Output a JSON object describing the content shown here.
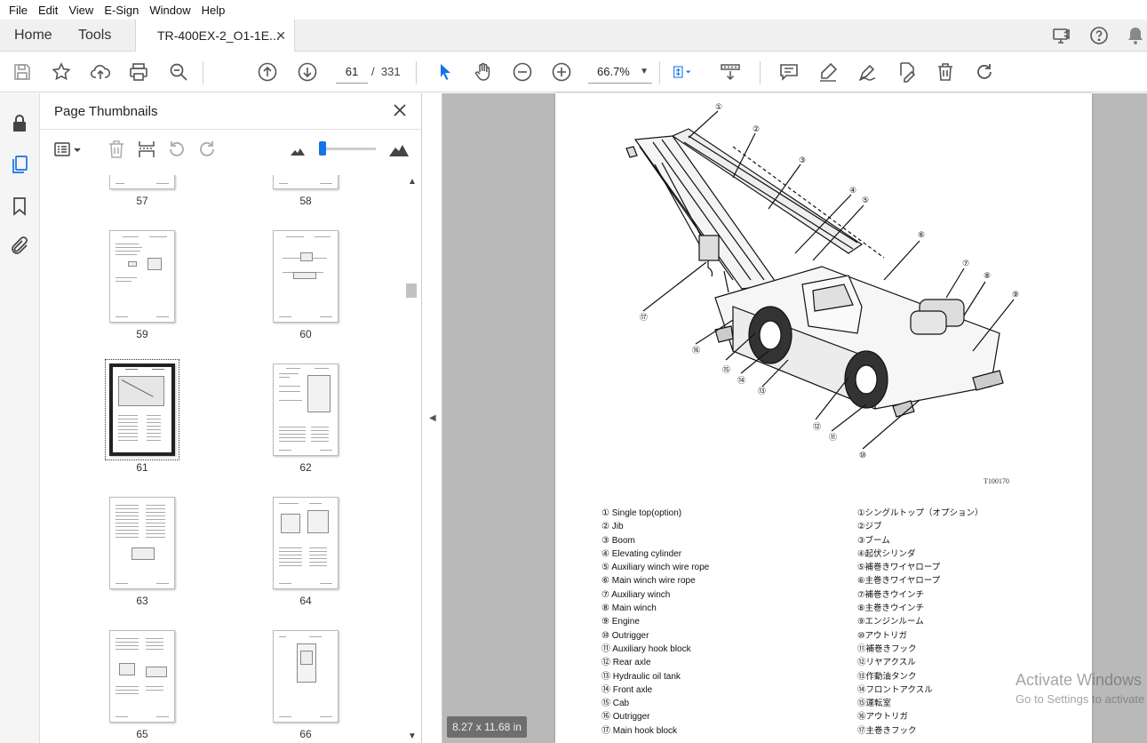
{
  "menu": [
    "File",
    "Edit",
    "View",
    "E-Sign",
    "Window",
    "Help"
  ],
  "tabs": {
    "home": "Home",
    "tools": "Tools",
    "document_title": "TR-400EX-2_O1-1E...",
    "close_glyph": "✕"
  },
  "toolbar": {
    "current_page": "61",
    "page_separator": "/",
    "total_pages": "331",
    "zoom": "66.7%"
  },
  "panel": {
    "title": "Page Thumbnails",
    "close_glyph": "✕",
    "thumbnails": [
      {
        "label": "57"
      },
      {
        "label": "58"
      },
      {
        "label": "59"
      },
      {
        "label": "60"
      },
      {
        "label": "61",
        "selected": true
      },
      {
        "label": "62"
      },
      {
        "label": "63"
      },
      {
        "label": "64"
      },
      {
        "label": "65"
      },
      {
        "label": "66"
      }
    ]
  },
  "document": {
    "figure_code": "T100170",
    "callouts": [
      "①",
      "②",
      "③",
      "④",
      "⑤",
      "⑥",
      "⑦",
      "⑧",
      "⑨",
      "⑩",
      "⑪",
      "⑫",
      "⑬",
      "⑭",
      "⑮",
      "⑯",
      "⑰"
    ],
    "legend_en": [
      "① Single top(option)",
      "② Jib",
      "③ Boom",
      "④ Elevating cylinder",
      "⑤ Auxiliary winch wire rope",
      "⑥ Main winch wire rope",
      "⑦ Auxiliary winch",
      "⑧ Main winch",
      "⑨ Engine",
      "⑩ Outrigger",
      "⑪ Auxiliary hook block",
      "⑫ Rear axle",
      "⑬ Hydraulic oil tank",
      "⑭ Front axle",
      "⑮ Cab",
      "⑯ Outrigger",
      "⑰ Main hook block"
    ],
    "legend_jp": [
      "①シングルトップ（オプション）",
      "②ジブ",
      "③ブーム",
      "④起伏シリンダ",
      "⑤補巻きワイヤロープ",
      "⑥主巻きワイヤロープ",
      "⑦補巻きウインチ",
      "⑧主巻きウインチ",
      "⑨エンジンルーム",
      "⑩アウトリガ",
      "⑪補巻きフック",
      "⑫リヤアクスル",
      "⑬作動油タンク",
      "⑭フロントアクスル",
      "⑮運転室",
      "⑯アウトリガ",
      "⑰主巻きフック"
    ]
  },
  "status": {
    "page_size": "8.27 x 11.68 in"
  },
  "watermark": {
    "line1": "Activate Windows",
    "line2": "Go to Settings to activate Windows."
  },
  "colors": {
    "accent": "#1473e6",
    "doc_background": "#b9b9b9"
  }
}
